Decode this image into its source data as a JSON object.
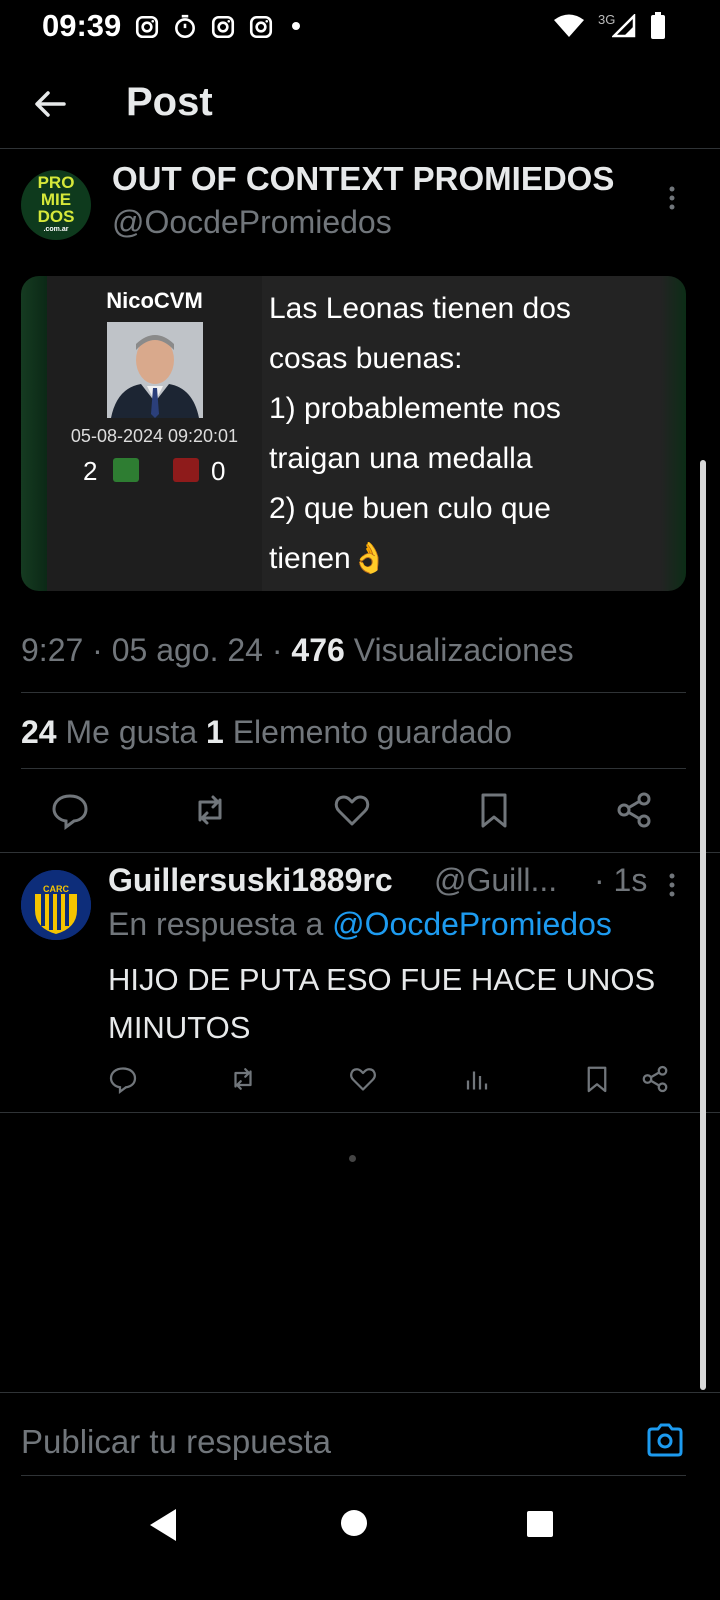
{
  "status_bar": {
    "time": "09:39",
    "network": "3G"
  },
  "header": {
    "title": "Post"
  },
  "post": {
    "author_name": "OUT OF CONTEXT PROMIEDOS",
    "author_handle": "@OocdePromiedos",
    "avatar_lines": [
      "PRO",
      "MIE",
      "DOS",
      ".com.ar"
    ],
    "media": {
      "username": "NicoCVM",
      "date": "05-08-2024 09:20:01",
      "likes": "2",
      "dislikes": "0",
      "text": "Las Leonas tienen dos\ncosas buenas:\n1) probablemente nos\ntraigan una medalla\n2) que buen culo que\ntienen👌"
    },
    "time": "9:27 · 05 ago. 24 · ",
    "views_count": "476",
    "views_label": " Visualizaciones",
    "likes_count": "24",
    "likes_label": " Me gusta  ",
    "bookmarks_count": "1",
    "bookmarks_label": " Elemento guardado"
  },
  "reply": {
    "name": "Guillersuski1889rc",
    "handle": "@Guill...",
    "time": "· 1s",
    "context_prefix": "En respuesta a ",
    "mention": "@OocdePromiedos",
    "text": "HIJO DE PUTA ESO FUE HACE UNOS MINUTOS",
    "avatar_label": "CARC"
  },
  "compose": {
    "placeholder": "Publicar tu respuesta"
  },
  "colors": {
    "accent": "#1d9bf0",
    "muted": "#71767b",
    "text": "#e7e9ea",
    "background": "#000000"
  },
  "icons": [
    "back-arrow-icon",
    "more-vertical-icon",
    "reply-icon",
    "repost-icon",
    "like-icon",
    "bookmark-icon",
    "share-icon",
    "views-icon",
    "camera-icon",
    "nav-back-icon",
    "nav-home-icon",
    "nav-recents-icon"
  ]
}
